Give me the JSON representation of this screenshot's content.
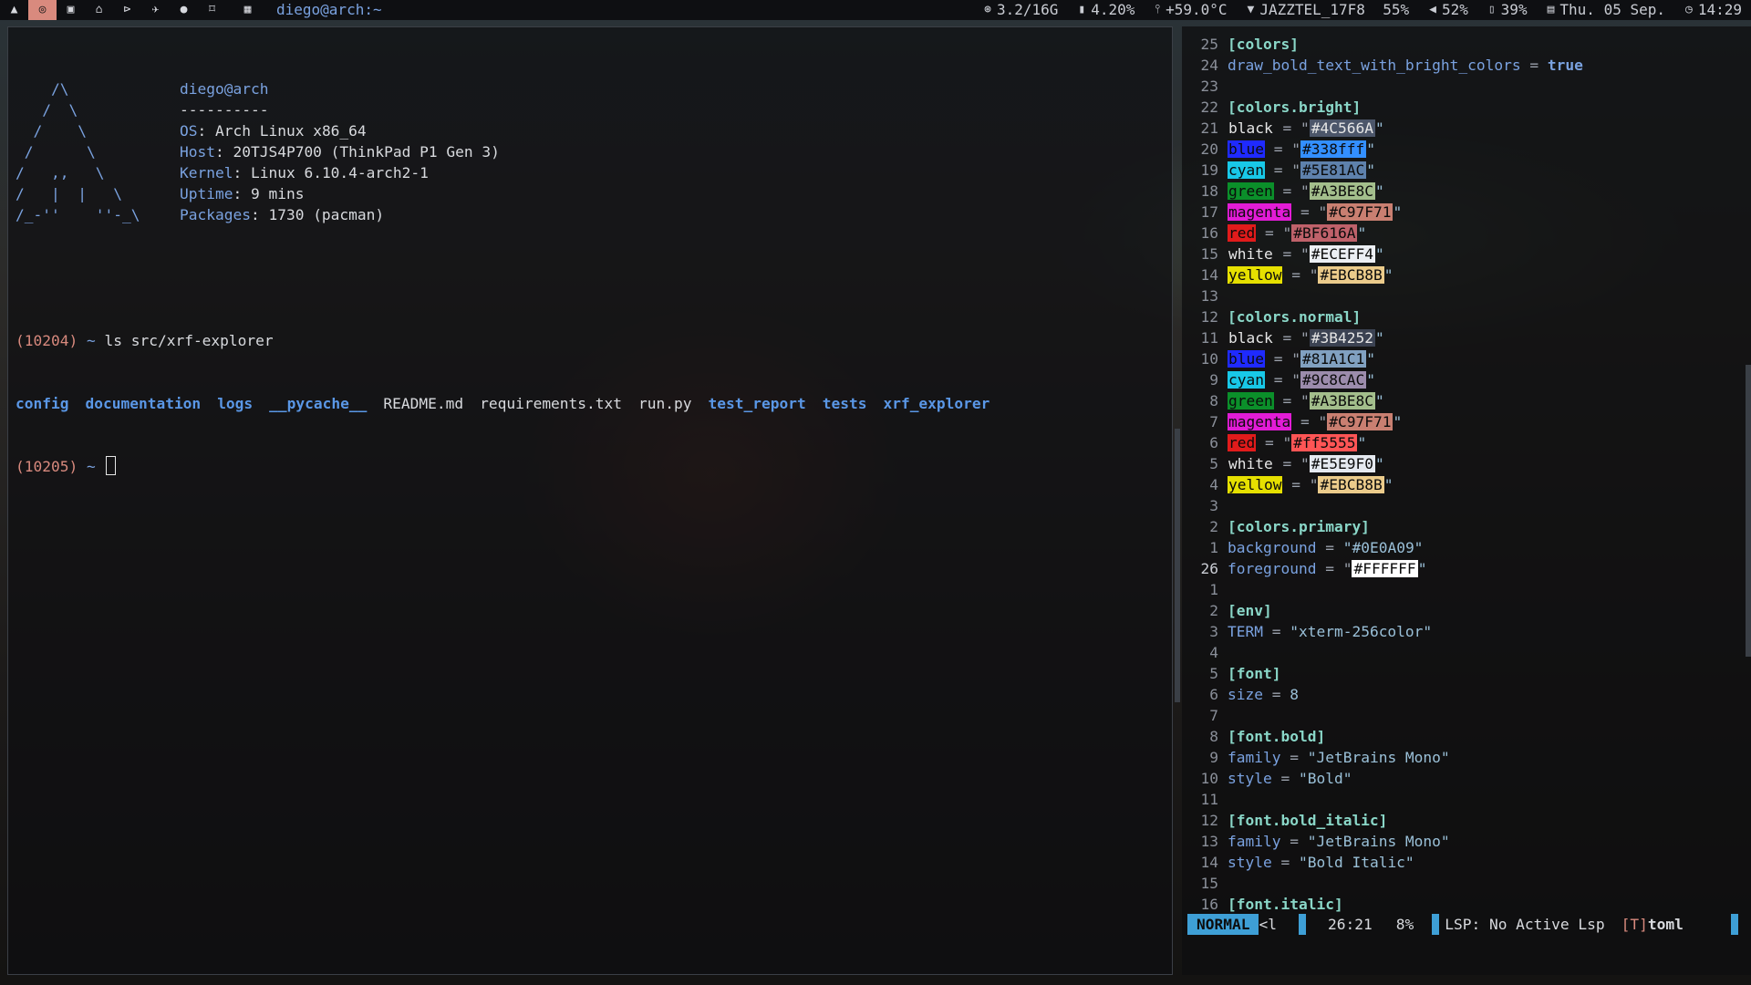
{
  "topbar": {
    "workspaces": [
      {
        "icon": "arch-logo-icon",
        "glyph": "▲"
      },
      {
        "icon": "browser-icon",
        "glyph": "◎"
      },
      {
        "icon": "terminal-icon",
        "glyph": "▣"
      },
      {
        "icon": "code-icon",
        "glyph": "⌂"
      },
      {
        "icon": "files-icon",
        "glyph": "⊳"
      },
      {
        "icon": "messaging-icon",
        "glyph": "✈"
      },
      {
        "icon": "music-icon",
        "glyph": "●"
      },
      {
        "icon": "lock-icon",
        "glyph": "⌑"
      }
    ],
    "layout_icon_glyph": "▦",
    "window_title": "diego@arch:~",
    "memory": "3.2/16G",
    "cpu": "4.20%",
    "temperature": "+59.0°C",
    "wifi": "JAZZTEL_17F8  55%",
    "volume": "52%",
    "battery": "39%",
    "date": "Thu. 05 Sep.",
    "time": "14:29"
  },
  "terminal": {
    "fetch": [
      {
        "art": "    /\\",
        "key": "",
        "value": "diego@arch"
      },
      {
        "art": "   /  \\",
        "key": "",
        "value": "----------"
      },
      {
        "art": "  /    \\",
        "key": "OS",
        "value": ": Arch Linux x86_64"
      },
      {
        "art": " /      \\",
        "key": "Host",
        "value": ": 20TJS4P700 (ThinkPad P1 Gen 3)"
      },
      {
        "art": "/   ,,   \\",
        "key": "Kernel",
        "value": ": Linux 6.10.4-arch2-1"
      },
      {
        "art": "/   |  |   \\",
        "key": "Uptime",
        "value": ": 9 mins"
      },
      {
        "art": "/_-''    ''-_\\",
        "key": "Packages",
        "value": ": 1730 (pacman)"
      }
    ],
    "cmd1_num": "(10204)",
    "cmd1_tilde": " ~ ",
    "cmd1_text": "ls src/xrf-explorer",
    "ls_entries": [
      {
        "name": "config",
        "type": "dir"
      },
      {
        "name": "documentation",
        "type": "dir"
      },
      {
        "name": "logs",
        "type": "dir"
      },
      {
        "name": "__pycache__",
        "type": "dir"
      },
      {
        "name": "README.md",
        "type": "file"
      },
      {
        "name": "requirements.txt",
        "type": "file"
      },
      {
        "name": "run.py",
        "type": "file"
      },
      {
        "name": "test_report",
        "type": "dir"
      },
      {
        "name": "tests",
        "type": "dir"
      },
      {
        "name": "xrf_explorer",
        "type": "dir"
      }
    ],
    "cmd2_num": "(10205)",
    "cmd2_tilde": " ~ "
  },
  "editor": {
    "lines": [
      {
        "n": "25",
        "t": "sec",
        "text": "[colors]"
      },
      {
        "n": "24",
        "t": "kv",
        "key": "draw_bold_text_with_bright_colors",
        "val": "true",
        "vt": "bool"
      },
      {
        "n": "23",
        "t": "blank"
      },
      {
        "n": "22",
        "t": "sec",
        "text": "[colors.bright]"
      },
      {
        "n": "21",
        "t": "color",
        "key": "black",
        "hex": "#4C566A",
        "kbg": "",
        "hbg": "#4C566A",
        "hfg": "#e6e6e6"
      },
      {
        "n": "20",
        "t": "color",
        "key": "blue",
        "hex": "#338fff",
        "kbg": "#1f2aff",
        "hbg": "#338fff",
        "hfg": "#0b0b0b"
      },
      {
        "n": "19",
        "t": "color",
        "key": "cyan",
        "hex": "#5E81AC",
        "kbg": "#18c8e8",
        "hbg": "#5E81AC",
        "hfg": "#0b0b0b"
      },
      {
        "n": "18",
        "t": "color",
        "key": "green",
        "hex": "#A3BE8C",
        "kbg": "#0b8f2a",
        "hbg": "#A3BE8C",
        "hfg": "#0b0b0b"
      },
      {
        "n": "17",
        "t": "color",
        "key": "magenta",
        "hex": "#C97F71",
        "kbg": "#e21cd6",
        "hbg": "#C97F71",
        "hfg": "#0b0b0b"
      },
      {
        "n": "16",
        "t": "color",
        "key": "red",
        "hex": "#BF616A",
        "kbg": "#e11b1b",
        "hbg": "#BF616A",
        "hfg": "#0b0b0b"
      },
      {
        "n": "15",
        "t": "color",
        "key": "white",
        "hex": "#ECEFF4",
        "kbg": "",
        "hbg": "#ECEFF4",
        "hfg": "#0b0b0b"
      },
      {
        "n": "14",
        "t": "color",
        "key": "yellow",
        "hex": "#EBCB8B",
        "kbg": "#e6e000",
        "hbg": "#EBCB8B",
        "hfg": "#0b0b0b"
      },
      {
        "n": "13",
        "t": "blank"
      },
      {
        "n": "12",
        "t": "sec",
        "text": "[colors.normal]"
      },
      {
        "n": "11",
        "t": "color",
        "key": "black",
        "hex": "#3B4252",
        "kbg": "",
        "hbg": "#3B4252",
        "hfg": "#e6e6e6"
      },
      {
        "n": "10",
        "t": "color",
        "key": "blue",
        "hex": "#81A1C1",
        "kbg": "#1f2aff",
        "hbg": "#81A1C1",
        "hfg": "#0b0b0b"
      },
      {
        "n": "9",
        "t": "color",
        "key": "cyan",
        "hex": "#9C8CAC",
        "kbg": "#18c8e8",
        "hbg": "#9C8CAC",
        "hfg": "#0b0b0b"
      },
      {
        "n": "8",
        "t": "color",
        "key": "green",
        "hex": "#A3BE8C",
        "kbg": "#0b8f2a",
        "hbg": "#A3BE8C",
        "hfg": "#0b0b0b"
      },
      {
        "n": "7",
        "t": "color",
        "key": "magenta",
        "hex": "#C97F71",
        "kbg": "#e21cd6",
        "hbg": "#C97F71",
        "hfg": "#0b0b0b"
      },
      {
        "n": "6",
        "t": "color",
        "key": "red",
        "hex": "#ff5555",
        "kbg": "#e11b1b",
        "hbg": "#ff5555",
        "hfg": "#0b0b0b"
      },
      {
        "n": "5",
        "t": "color",
        "key": "white",
        "hex": "#E5E9F0",
        "kbg": "",
        "hbg": "#E5E9F0",
        "hfg": "#0b0b0b"
      },
      {
        "n": "4",
        "t": "color",
        "key": "yellow",
        "hex": "#EBCB8B",
        "kbg": "#e6e000",
        "hbg": "#EBCB8B",
        "hfg": "#0b0b0b"
      },
      {
        "n": "3",
        "t": "blank"
      },
      {
        "n": "2",
        "t": "sec",
        "text": "[colors.primary]"
      },
      {
        "n": "1",
        "t": "kv",
        "key": "background",
        "val": "\"#0E0A09\"",
        "vt": "str"
      },
      {
        "n": "26",
        "t": "kvcur",
        "key": "foreground",
        "val": "#FFFFFF",
        "cur": true
      },
      {
        "n": "1",
        "t": "blank"
      },
      {
        "n": "2",
        "t": "sec",
        "text": "[env]"
      },
      {
        "n": "3",
        "t": "kv",
        "key": "TERM",
        "val": "\"xterm-256color\"",
        "vt": "str"
      },
      {
        "n": "4",
        "t": "blank"
      },
      {
        "n": "5",
        "t": "sec",
        "text": "[font]"
      },
      {
        "n": "6",
        "t": "kv",
        "key": "size",
        "val": "8",
        "vt": "str"
      },
      {
        "n": "7",
        "t": "blank"
      },
      {
        "n": "8",
        "t": "sec",
        "text": "[font.bold]"
      },
      {
        "n": "9",
        "t": "kv",
        "key": "family",
        "val": "\"JetBrains Mono\"",
        "vt": "str"
      },
      {
        "n": "10",
        "t": "kv",
        "key": "style",
        "val": "\"Bold\"",
        "vt": "str"
      },
      {
        "n": "11",
        "t": "blank"
      },
      {
        "n": "12",
        "t": "sec",
        "text": "[font.bold_italic]"
      },
      {
        "n": "13",
        "t": "kv",
        "key": "family",
        "val": "\"JetBrains Mono\"",
        "vt": "str"
      },
      {
        "n": "14",
        "t": "kv",
        "key": "style",
        "val": "\"Bold Italic\"",
        "vt": "str"
      },
      {
        "n": "15",
        "t": "blank"
      },
      {
        "n": "16",
        "t": "sec",
        "text": "[font.italic]"
      }
    ],
    "statusline": {
      "mode": "NORMAL",
      "pending": "<l",
      "position": "26:21",
      "percent": "8%",
      "lsp": "LSP: No Active Lsp",
      "ft_icon": "[T]",
      "filetype": "toml"
    }
  }
}
